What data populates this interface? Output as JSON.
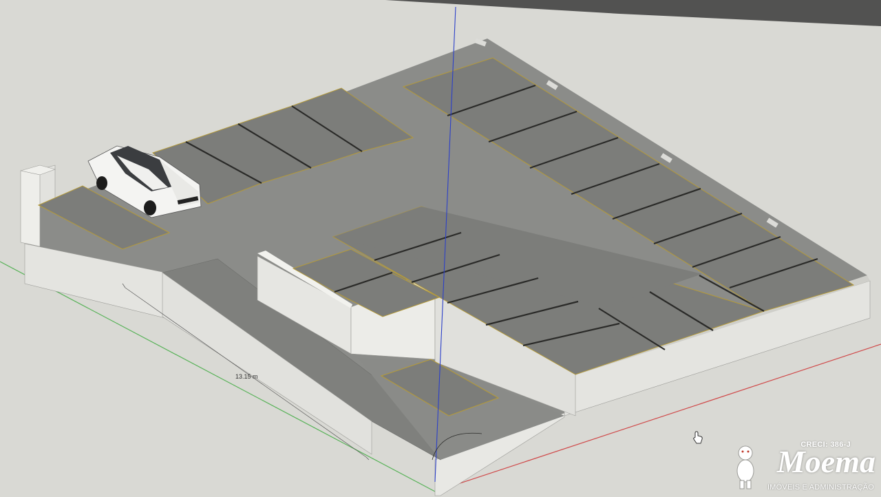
{
  "model": {
    "dimension_label": "13.15 m",
    "colors": {
      "background": "#d9d9d4",
      "floor": "#8b8c89",
      "stall": "#7c7d7a",
      "wall_face": "#e4e4e0",
      "wall_side": "#c8c8c3",
      "stall_line": "#b49a3a",
      "axis_blue": "#2b3fc9",
      "axis_green": "#57b257",
      "axis_red": "#d04a4a"
    },
    "objects": [
      "parked-car",
      "access-ramp",
      "parking-stalls",
      "perimeter-walls",
      "lower-pit"
    ]
  },
  "watermark": {
    "creci": "CRECI: 386-J",
    "brand": "Moema",
    "subtitle": "IMÓVEIS E ADMINISTRAÇÃO"
  },
  "icons": {
    "cursor": "hand-cursor-icon",
    "mascot": "mascot-icon"
  }
}
